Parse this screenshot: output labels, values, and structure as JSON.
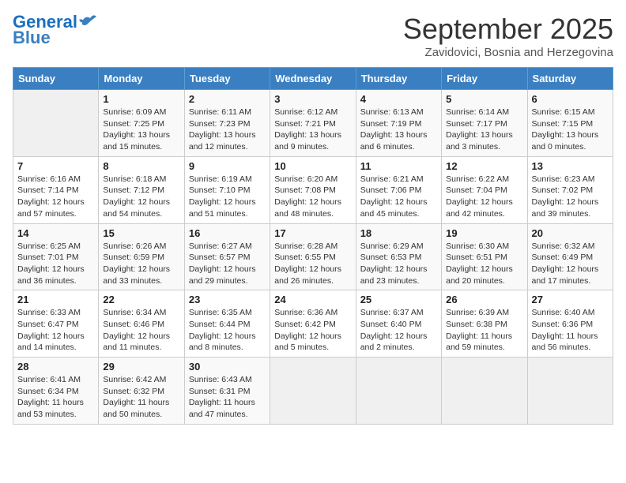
{
  "header": {
    "logo_line1": "General",
    "logo_line2": "Blue",
    "month_title": "September 2025",
    "subtitle": "Zavidovici, Bosnia and Herzegovina"
  },
  "weekdays": [
    "Sunday",
    "Monday",
    "Tuesday",
    "Wednesday",
    "Thursday",
    "Friday",
    "Saturday"
  ],
  "weeks": [
    [
      {
        "day": "",
        "info": ""
      },
      {
        "day": "1",
        "info": "Sunrise: 6:09 AM\nSunset: 7:25 PM\nDaylight: 13 hours\nand 15 minutes."
      },
      {
        "day": "2",
        "info": "Sunrise: 6:11 AM\nSunset: 7:23 PM\nDaylight: 13 hours\nand 12 minutes."
      },
      {
        "day": "3",
        "info": "Sunrise: 6:12 AM\nSunset: 7:21 PM\nDaylight: 13 hours\nand 9 minutes."
      },
      {
        "day": "4",
        "info": "Sunrise: 6:13 AM\nSunset: 7:19 PM\nDaylight: 13 hours\nand 6 minutes."
      },
      {
        "day": "5",
        "info": "Sunrise: 6:14 AM\nSunset: 7:17 PM\nDaylight: 13 hours\nand 3 minutes."
      },
      {
        "day": "6",
        "info": "Sunrise: 6:15 AM\nSunset: 7:15 PM\nDaylight: 13 hours\nand 0 minutes."
      }
    ],
    [
      {
        "day": "7",
        "info": "Sunrise: 6:16 AM\nSunset: 7:14 PM\nDaylight: 12 hours\nand 57 minutes."
      },
      {
        "day": "8",
        "info": "Sunrise: 6:18 AM\nSunset: 7:12 PM\nDaylight: 12 hours\nand 54 minutes."
      },
      {
        "day": "9",
        "info": "Sunrise: 6:19 AM\nSunset: 7:10 PM\nDaylight: 12 hours\nand 51 minutes."
      },
      {
        "day": "10",
        "info": "Sunrise: 6:20 AM\nSunset: 7:08 PM\nDaylight: 12 hours\nand 48 minutes."
      },
      {
        "day": "11",
        "info": "Sunrise: 6:21 AM\nSunset: 7:06 PM\nDaylight: 12 hours\nand 45 minutes."
      },
      {
        "day": "12",
        "info": "Sunrise: 6:22 AM\nSunset: 7:04 PM\nDaylight: 12 hours\nand 42 minutes."
      },
      {
        "day": "13",
        "info": "Sunrise: 6:23 AM\nSunset: 7:02 PM\nDaylight: 12 hours\nand 39 minutes."
      }
    ],
    [
      {
        "day": "14",
        "info": "Sunrise: 6:25 AM\nSunset: 7:01 PM\nDaylight: 12 hours\nand 36 minutes."
      },
      {
        "day": "15",
        "info": "Sunrise: 6:26 AM\nSunset: 6:59 PM\nDaylight: 12 hours\nand 33 minutes."
      },
      {
        "day": "16",
        "info": "Sunrise: 6:27 AM\nSunset: 6:57 PM\nDaylight: 12 hours\nand 29 minutes."
      },
      {
        "day": "17",
        "info": "Sunrise: 6:28 AM\nSunset: 6:55 PM\nDaylight: 12 hours\nand 26 minutes."
      },
      {
        "day": "18",
        "info": "Sunrise: 6:29 AM\nSunset: 6:53 PM\nDaylight: 12 hours\nand 23 minutes."
      },
      {
        "day": "19",
        "info": "Sunrise: 6:30 AM\nSunset: 6:51 PM\nDaylight: 12 hours\nand 20 minutes."
      },
      {
        "day": "20",
        "info": "Sunrise: 6:32 AM\nSunset: 6:49 PM\nDaylight: 12 hours\nand 17 minutes."
      }
    ],
    [
      {
        "day": "21",
        "info": "Sunrise: 6:33 AM\nSunset: 6:47 PM\nDaylight: 12 hours\nand 14 minutes."
      },
      {
        "day": "22",
        "info": "Sunrise: 6:34 AM\nSunset: 6:46 PM\nDaylight: 12 hours\nand 11 minutes."
      },
      {
        "day": "23",
        "info": "Sunrise: 6:35 AM\nSunset: 6:44 PM\nDaylight: 12 hours\nand 8 minutes."
      },
      {
        "day": "24",
        "info": "Sunrise: 6:36 AM\nSunset: 6:42 PM\nDaylight: 12 hours\nand 5 minutes."
      },
      {
        "day": "25",
        "info": "Sunrise: 6:37 AM\nSunset: 6:40 PM\nDaylight: 12 hours\nand 2 minutes."
      },
      {
        "day": "26",
        "info": "Sunrise: 6:39 AM\nSunset: 6:38 PM\nDaylight: 11 hours\nand 59 minutes."
      },
      {
        "day": "27",
        "info": "Sunrise: 6:40 AM\nSunset: 6:36 PM\nDaylight: 11 hours\nand 56 minutes."
      }
    ],
    [
      {
        "day": "28",
        "info": "Sunrise: 6:41 AM\nSunset: 6:34 PM\nDaylight: 11 hours\nand 53 minutes."
      },
      {
        "day": "29",
        "info": "Sunrise: 6:42 AM\nSunset: 6:32 PM\nDaylight: 11 hours\nand 50 minutes."
      },
      {
        "day": "30",
        "info": "Sunrise: 6:43 AM\nSunset: 6:31 PM\nDaylight: 11 hours\nand 47 minutes."
      },
      {
        "day": "",
        "info": ""
      },
      {
        "day": "",
        "info": ""
      },
      {
        "day": "",
        "info": ""
      },
      {
        "day": "",
        "info": ""
      }
    ]
  ]
}
